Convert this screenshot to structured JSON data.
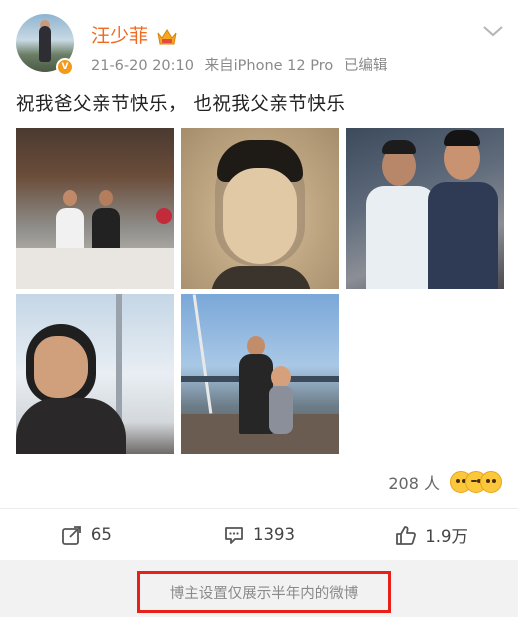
{
  "post": {
    "username": "汪少菲",
    "verified_badge": "V",
    "timestamp": "21-6-20 20:10",
    "source": "来自iPhone 12 Pro",
    "edited": "已编辑",
    "text": "祝我爸父亲节快乐， 也祝我父亲节快乐",
    "image_count": 5,
    "reaction_count": "208 人",
    "reaction_icons": [
      "grin-emoji-icon",
      "laugh-emoji-icon",
      "surprised-emoji-icon"
    ]
  },
  "actions": {
    "repost": "65",
    "comment": "1393",
    "like": "1.9万"
  },
  "footer": {
    "notice": "博主设置仅展示半年内的微博"
  },
  "colors": {
    "username": "#f06a21",
    "verified": "#f39a1a",
    "notice_border": "#e8201a",
    "meta": "#8a8a8a"
  }
}
